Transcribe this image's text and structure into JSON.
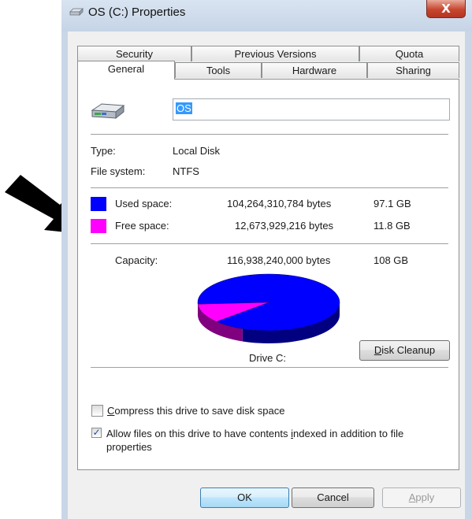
{
  "window": {
    "title": "OS (C:) Properties",
    "close_label": "X"
  },
  "tabs": {
    "row1": [
      "Security",
      "Previous Versions",
      "Quota"
    ],
    "row2": [
      "General",
      "Tools",
      "Hardware",
      "Sharing"
    ],
    "active": "General"
  },
  "general": {
    "drive_name": "OS",
    "type_label": "Type:",
    "type_value": "Local Disk",
    "fs_label": "File system:",
    "fs_value": "NTFS",
    "used_label": "Used space:",
    "used_bytes": "104,264,310,784 bytes",
    "used_gb": "97.1 GB",
    "free_label": "Free space:",
    "free_bytes": "12,673,929,216 bytes",
    "free_gb": "11.8 GB",
    "capacity_label": "Capacity:",
    "capacity_bytes": "116,938,240,000 bytes",
    "capacity_gb": "108 GB",
    "drive_caption": "Drive C:",
    "disk_cleanup_rest": "isk Cleanup",
    "disk_cleanup_key": "D",
    "used_fraction": 0.892,
    "colors": {
      "used": "#0000ff",
      "free": "#ff00ff"
    }
  },
  "options": {
    "compress_key": "C",
    "compress_rest": "ompress this drive to save disk space",
    "compress_checked": false,
    "index_pre": "Allow files on this drive to have contents ",
    "index_key": "i",
    "index_post": "ndexed in addition to file",
    "index_line2": "properties",
    "index_checked": true
  },
  "buttons": {
    "ok": "OK",
    "cancel": "Cancel",
    "apply_key": "A",
    "apply_rest": "pply"
  }
}
